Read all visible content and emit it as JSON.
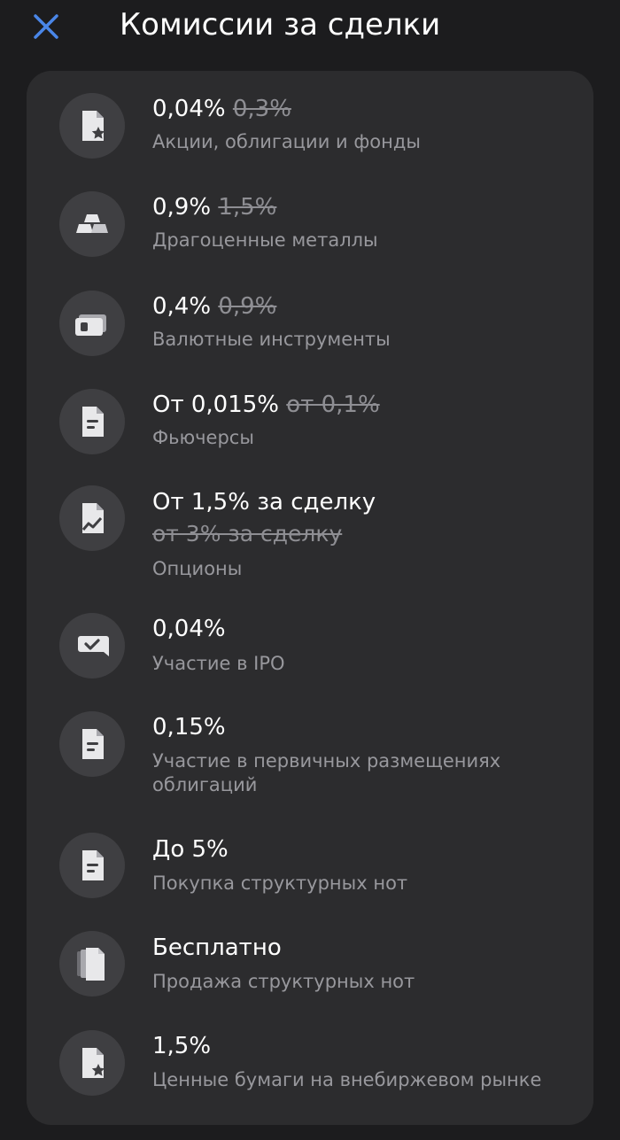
{
  "header": {
    "title": "Комиссии за сделки",
    "close_icon": "close-icon",
    "accent_color": "#4a86e8"
  },
  "items": [
    {
      "rate": "0,04%",
      "old": "0,3%",
      "label": "Акции, облигации и фонды",
      "icon": "stock-document-icon"
    },
    {
      "rate": "0,9%",
      "old": "1,5%",
      "label": "Драгоценные металлы",
      "icon": "gold-bars-icon"
    },
    {
      "rate": "0,4%",
      "old": "0,9%",
      "label": "Валютные инструменты",
      "icon": "banknote-icon"
    },
    {
      "rate": "От 0,015%",
      "old": "от 0,1%",
      "label": "Фьючерсы",
      "icon": "document-icon"
    },
    {
      "rate": "От 1,5% за сделку",
      "old": "от 3% за сделку",
      "label": "Опционы",
      "icon": "chart-document-icon"
    },
    {
      "rate": "0,04%",
      "old": "",
      "label": "Участие в IPO",
      "icon": "check-message-icon"
    },
    {
      "rate": "0,15%",
      "old": "",
      "label": "Участие в первичных размещениях облигаций",
      "icon": "document-icon"
    },
    {
      "rate": "До 5%",
      "old": "",
      "label": "Покупка структурных нот",
      "icon": "document-icon"
    },
    {
      "rate": "Бесплатно",
      "old": "",
      "label": "Продажа структурных нот",
      "icon": "stacked-documents-icon"
    },
    {
      "rate": "1,5%",
      "old": "",
      "label": "Ценные бумаги на внебиржевом рынке",
      "icon": "stock-document-icon"
    }
  ]
}
